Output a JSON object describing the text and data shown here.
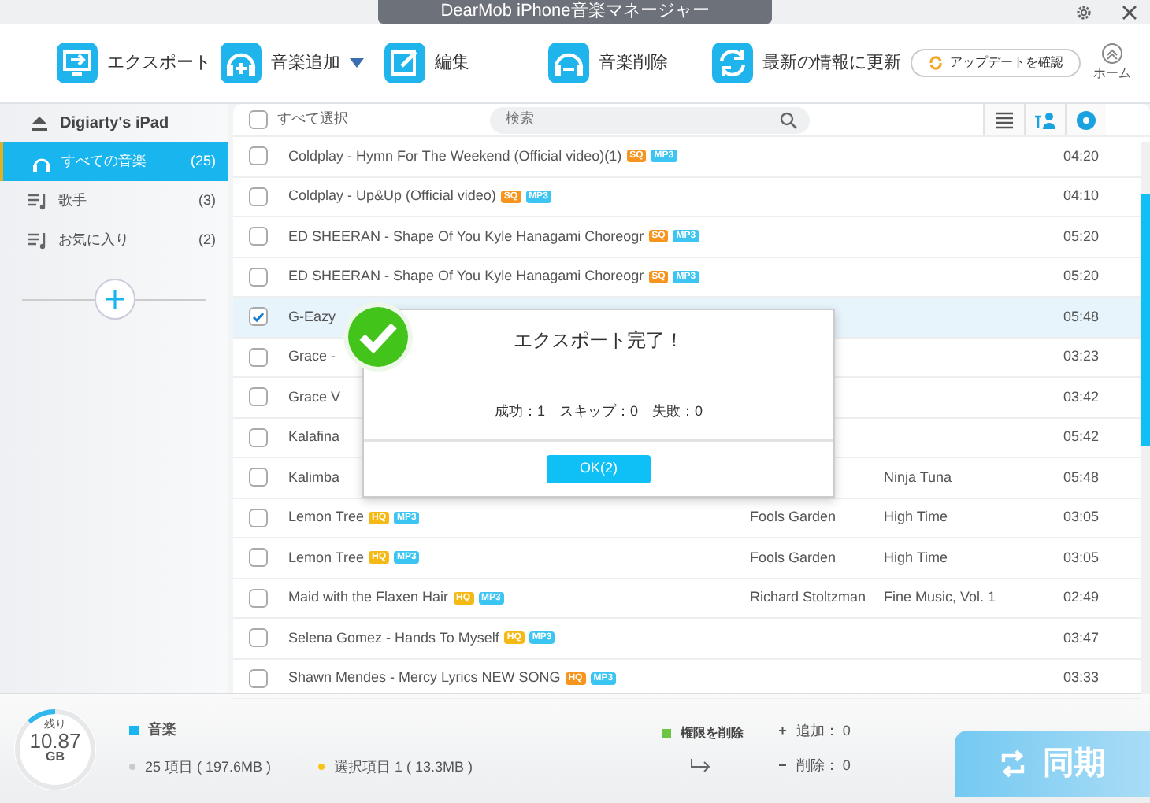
{
  "window": {
    "title": "DearMob iPhone音楽マネージャー"
  },
  "toolbar": [
    {
      "label": "エクスポート",
      "kind": "export",
      "dropdown": false
    },
    {
      "label": "音楽追加",
      "kind": "add",
      "dropdown": true
    },
    {
      "label": "編集",
      "kind": "edit",
      "dropdown": false
    },
    {
      "label": "音楽削除",
      "kind": "remove",
      "dropdown": false
    },
    {
      "label": "最新の情報に更新",
      "kind": "refresh",
      "dropdown": false
    }
  ],
  "update_button": "アップデートを確認",
  "home_button": "ホーム",
  "sidebar": {
    "device": "Digiarty's iPad",
    "items": [
      {
        "label": "すべての音楽",
        "count": "(25)",
        "kind": "music",
        "selected": true
      },
      {
        "label": "歌手",
        "count": "(3)",
        "kind": "playlist",
        "selected": false
      },
      {
        "label": "お気に入り",
        "count": "(2)",
        "kind": "playlist",
        "selected": false
      }
    ]
  },
  "list": {
    "select_all": "すべて選択",
    "select_all_checked": false,
    "search_placeholder": "検索",
    "view_tabs": [
      {
        "kind": "list"
      },
      {
        "kind": "artist"
      },
      {
        "kind": "album"
      }
    ],
    "rows": [
      {
        "title": "Coldplay - Hymn For The Weekend (Official video)(1)",
        "badges": [
          {
            "label": "SQ",
            "color": "#f7941d"
          },
          {
            "label": "MP3",
            "color": "#3cc5f2"
          }
        ],
        "time": "04:20",
        "checked": false,
        "selected": false
      },
      {
        "title": "Coldplay - Up&Up (Official video)",
        "badges": [
          {
            "label": "SQ",
            "color": "#f7941d"
          },
          {
            "label": "MP3",
            "color": "#3cc5f2"
          }
        ],
        "time": "04:10",
        "checked": false,
        "selected": false
      },
      {
        "title": "ED SHEERAN - Shape Of You   Kyle Hanagami Choreogr",
        "badges": [
          {
            "label": "SQ",
            "color": "#f7941d"
          },
          {
            "label": "MP3",
            "color": "#3cc5f2"
          }
        ],
        "time": "05:20",
        "checked": false,
        "selected": false
      },
      {
        "title": "ED SHEERAN - Shape Of You   Kyle Hanagami Choreogr",
        "badges": [
          {
            "label": "SQ",
            "color": "#f7941d"
          },
          {
            "label": "MP3",
            "color": "#3cc5f2"
          }
        ],
        "time": "05:20",
        "checked": false,
        "selected": false
      },
      {
        "title": "G-Eazy",
        "time": "05:48",
        "checked": true,
        "selected": true
      },
      {
        "title": "Grace -",
        "time": "03:23",
        "checked": false,
        "selected": false
      },
      {
        "title": "Grace V",
        "time": "03:42",
        "checked": false,
        "selected": false
      },
      {
        "title": "Kalafina",
        "time": "05:42",
        "checked": false,
        "selected": false
      },
      {
        "title": "Kalimba",
        "album": "Ninja Tuna",
        "time": "05:48",
        "checked": false,
        "selected": false
      },
      {
        "title": "Lemon Tree",
        "badges": [
          {
            "label": "HQ",
            "color": "#f5b915"
          },
          {
            "label": "MP3",
            "color": "#3cc5f2"
          }
        ],
        "artist": "Fools Garden",
        "album": "High Time",
        "time": "03:05",
        "checked": false,
        "selected": false
      },
      {
        "title": "Lemon Tree",
        "badges": [
          {
            "label": "HQ",
            "color": "#f5b915"
          },
          {
            "label": "MP3",
            "color": "#3cc5f2"
          }
        ],
        "artist": "Fools Garden",
        "album": "High Time",
        "time": "03:05",
        "checked": false,
        "selected": false
      },
      {
        "title": "Maid with the Flaxen Hair",
        "badges": [
          {
            "label": "HQ",
            "color": "#f5b915"
          },
          {
            "label": "MP3",
            "color": "#3cc5f2"
          }
        ],
        "artist": "Richard Stoltzman",
        "album": "Fine Music, Vol. 1",
        "time": "02:49",
        "checked": false,
        "selected": false
      },
      {
        "title": "Selena Gomez - Hands To Myself",
        "badges": [
          {
            "label": "HQ",
            "color": "#f5b915"
          },
          {
            "label": "MP3",
            "color": "#3cc5f2"
          }
        ],
        "time": "03:47",
        "checked": false,
        "selected": false
      },
      {
        "title": "Shawn Mendes - Mercy Lyrics NEW SONG",
        "badges": [
          {
            "label": "HQ",
            "color": "#f7941d"
          },
          {
            "label": "MP3",
            "color": "#3cc5f2"
          }
        ],
        "time": "03:33",
        "checked": false,
        "selected": false
      }
    ]
  },
  "dialog": {
    "title": "エクスポート完了！",
    "message": "成功：1　スキップ：0　失敗：0",
    "button": "OK(2)"
  },
  "status": {
    "storage": {
      "label": "残り",
      "value": "10.87",
      "unit": "GB",
      "level": 0.12
    },
    "legend": {
      "label": "音楽",
      "color": "#18b5ee"
    },
    "items": [
      {
        "text": "25 項目 ( 197.6MB )",
        "color": "#c8ccd2"
      },
      {
        "text": "選択項目 1 ( 13.3MB )",
        "color": "#f5c518"
      }
    ],
    "permission": {
      "label": "権限を削除",
      "color": "#6cc644"
    },
    "changes": [
      {
        "sign": "+",
        "text": "追加： 0"
      },
      {
        "sign": "−",
        "text": "削除： 0"
      }
    ],
    "sync_button": "同期"
  }
}
